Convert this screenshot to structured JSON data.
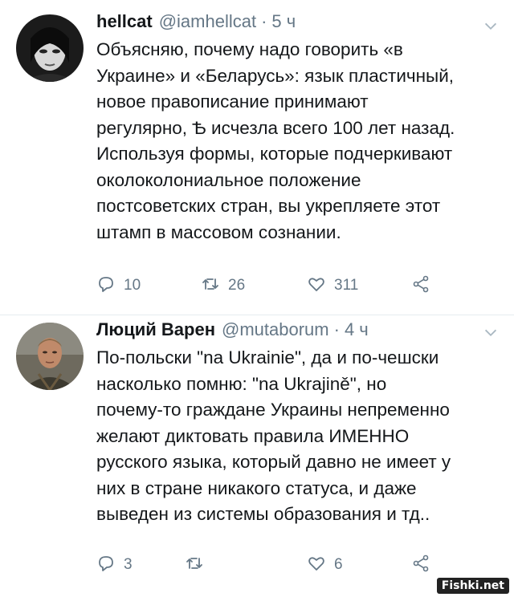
{
  "tweets": [
    {
      "name": "hellcat",
      "handle": "@iamhellcat",
      "dot": "·",
      "time": "5 ч",
      "text": "Объясняю, почему надо говорить «в\nУкраине» и «Беларусь»: язык пластичный,\nновое правописание принимают\nрегулярно, Ѣ исчезла всего 100 лет назад.\nИспользуя формы, которые подчеркивают\nоколоколониальное положение\nпостсоветских стран, вы укрепляете этот\nштамп в массовом сознании.",
      "replies": "10",
      "retweets": "26",
      "likes": "311",
      "avatar_icon": "avatar-dark-portrait"
    },
    {
      "name": "Люций Варен",
      "handle": "@mutaborum",
      "dot": "·",
      "time": "4 ч",
      "text": "По-польски \"na Ukrainie\", да и по-чешски\nнасколько помню: \"na Ukrajině\", но\nпочему-то граждане Украины непременно\nжелают диктовать правила ИМЕННО\nрусского языка, который давно не имеет у\nних в стране никакого статуса, и даже\nвыведен из системы образования и тд..",
      "replies": "3",
      "retweets": "",
      "likes": "6",
      "avatar_icon": "avatar-man-portrait"
    }
  ],
  "watermark": "Fishki.net",
  "colors": {
    "text": "#14171a",
    "secondary": "#657786",
    "divider": "#e6ecf0"
  }
}
